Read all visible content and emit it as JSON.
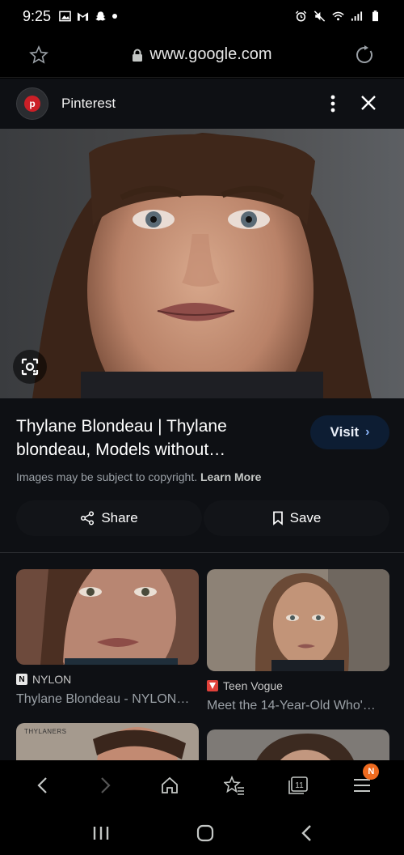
{
  "status_bar": {
    "time": "9:25"
  },
  "url_bar": {
    "url": "www.google.com"
  },
  "sheet_header": {
    "site_name": "Pinterest",
    "site_initial": "p"
  },
  "result": {
    "title": "Thylane Blondeau | Thylane blondeau, Models without…",
    "visit_label": "Visit",
    "copyright_text": "Images may be subject to copyright.",
    "learn_more_label": "Learn More",
    "share_label": "Share",
    "save_label": "Save"
  },
  "related": [
    {
      "source": "NYLON",
      "source_badge": "N",
      "badge_color": "#e8e8e8",
      "caption": "Thylane Blondeau - NYLON…"
    },
    {
      "source": "Teen Vogue",
      "source_badge": "",
      "badge_color": "#e0413a",
      "caption": "Meet the 14-Year-Old Who'…"
    },
    {
      "source": "",
      "watermark": "THYLANERS",
      "caption": ""
    },
    {
      "source": "",
      "caption": ""
    }
  ],
  "browser_nav": {
    "tab_count": "11",
    "notification_badge": "N"
  },
  "colors": {
    "accent": "#8ab4f8",
    "sheet_bg": "#0e1014",
    "notification": "#f06b1f"
  }
}
